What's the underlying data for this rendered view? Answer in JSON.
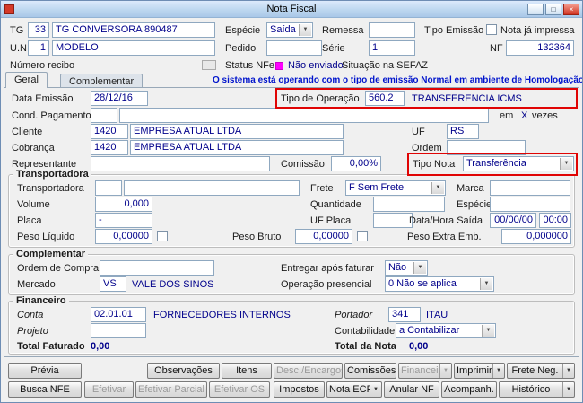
{
  "window": {
    "title": "Nota Fiscal",
    "minimize_glyph": "_",
    "maximize_glyph": "□",
    "close_glyph": "×"
  },
  "ui": {
    "dd_glyph": "▼"
  },
  "header": {
    "tg": {
      "label": "TG",
      "code": "33",
      "name": "TG CONVERSORA 890487"
    },
    "especie": {
      "label": "Espécie",
      "value": "Saída"
    },
    "remessa": {
      "label": "Remessa",
      "value": ""
    },
    "tipo_emissao": {
      "label": "Tipo Emissão",
      "value": ""
    },
    "nota_ja_impressa": {
      "label": "Nota já impressa",
      "checked": false
    },
    "un": {
      "label": "U.N.",
      "code": "1",
      "name": "MODELO"
    },
    "pedido": {
      "label": "Pedido",
      "value": ""
    },
    "serie": {
      "label": "Série",
      "value": "1"
    },
    "nf": {
      "label": "NF",
      "value": "132364"
    },
    "numero_recibo": {
      "label": "Número recibo",
      "button": "..."
    },
    "status_nfe": {
      "label": "Status NFe",
      "value": "Não enviado"
    },
    "situacao_sefaz": {
      "label": "Situação na SEFAZ"
    }
  },
  "tabs": [
    {
      "label": "Geral",
      "active": true
    },
    {
      "label": "Complementar",
      "active": false
    }
  ],
  "banner": "O sistema está operando com o tipo de emissão Normal em ambiente de Homologação",
  "geral": {
    "data_emissao": {
      "label": "Data Emissão",
      "value": "28/12/16"
    },
    "tipo_operacao": {
      "label": "Tipo de Operação",
      "code": "560.2",
      "name": "TRANSFERENCIA ICMS"
    },
    "cond_pagamento": {
      "label": "Cond. Pagamento",
      "code": "",
      "name": "",
      "em": "em",
      "x": "X",
      "vezes": "vezes"
    },
    "cliente": {
      "label": "Cliente",
      "code": "1420",
      "name": "EMPRESA ATUAL LTDA"
    },
    "uf": {
      "label": "UF",
      "value": "RS"
    },
    "cobranca": {
      "label": "Cobrança",
      "code": "1420",
      "name": "EMPRESA ATUAL LTDA"
    },
    "ordem": {
      "label": "Ordem",
      "value": ""
    },
    "representante": {
      "label": "Representante",
      "value": ""
    },
    "comissao": {
      "label": "Comissão",
      "value": "0,00%"
    },
    "tipo_nota": {
      "label": "Tipo Nota",
      "value": "Transferência"
    }
  },
  "transportadora": {
    "title": "Transportadora",
    "transportadora": {
      "label": "Transportadora",
      "code": "",
      "name": ""
    },
    "frete": {
      "label": "Frete",
      "value": "F Sem Frete"
    },
    "marca": {
      "label": "Marca",
      "value": ""
    },
    "volume": {
      "label": "Volume",
      "value": "0,000"
    },
    "quantidade": {
      "label": "Quantidade",
      "value": ""
    },
    "especie": {
      "label": "Espécie",
      "value": ""
    },
    "placa": {
      "label": "Placa",
      "value": "-"
    },
    "uf_placa": {
      "label": "UF Placa",
      "value": ""
    },
    "data_hora_saida": {
      "label": "Data/Hora Saída",
      "date": "00/00/00",
      "time": "00:00"
    },
    "peso_liquido": {
      "label": "Peso Líquido",
      "value": "0,00000",
      "checked": false
    },
    "peso_bruto": {
      "label": "Peso Bruto",
      "value": "0,00000",
      "checked": false
    },
    "peso_extra": {
      "label": "Peso Extra Emb.",
      "value": "0,000000"
    }
  },
  "complementar": {
    "title": "Complementar",
    "ordem_compra": {
      "label": "Ordem de Compra",
      "value": ""
    },
    "entregar_apos": {
      "label": "Entregar após faturar",
      "value": "Não"
    },
    "mercado": {
      "label": "Mercado",
      "code": "VS",
      "name": "VALE DOS SINOS"
    },
    "operacao_presencial": {
      "label": "Operação presencial",
      "value": "0 Não se aplica"
    }
  },
  "financeiro": {
    "title": "Financeiro",
    "conta": {
      "label": "Conta",
      "code": "02.01.01",
      "name": "FORNECEDORES INTERNOS"
    },
    "portador": {
      "label": "Portador",
      "code": "341",
      "name": "ITAU"
    },
    "projeto": {
      "label": "Projeto",
      "value": ""
    },
    "contabilidade": {
      "label": "Contabilidade",
      "value": "a Contabilizar"
    },
    "total_faturado": {
      "label": "Total Faturado",
      "value": "0,00"
    },
    "total_nota": {
      "label": "Total da Nota",
      "value": "0,00"
    }
  },
  "buttons": {
    "row1": [
      {
        "label": "Prévia",
        "disabled": false
      },
      {
        "label": "Observações",
        "disabled": false
      },
      {
        "label": "Itens",
        "disabled": false
      },
      {
        "label": "Desc./Encargos",
        "disabled": true
      },
      {
        "label": "Comissões",
        "disabled": false
      },
      {
        "label": "Financeiro",
        "disabled": true,
        "split": true
      },
      {
        "label": "Imprimir",
        "disabled": false,
        "split": true
      },
      {
        "label": "Frete Neg.",
        "disabled": false,
        "split": true
      }
    ],
    "row2": [
      {
        "label": "Busca NFE",
        "disabled": false
      },
      {
        "label": "Efetivar",
        "disabled": true
      },
      {
        "label": "Efetivar Parcial",
        "disabled": true
      },
      {
        "label": "Efetivar OS",
        "disabled": true
      },
      {
        "label": "Impostos",
        "disabled": false
      },
      {
        "label": "Nota ECF",
        "disabled": false,
        "split": true
      },
      {
        "label": "Anular NF",
        "disabled": false
      },
      {
        "label": "Acompanh.",
        "disabled": false
      },
      {
        "label": "Histórico",
        "disabled": false,
        "split": true
      }
    ]
  },
  "colors": {
    "value_text": "#00008B",
    "banner_text": "#0014CC",
    "highlight_border": "#E00404",
    "status_nfe_icon": "#FF00FF",
    "titlebar": "#BDD7F0"
  }
}
